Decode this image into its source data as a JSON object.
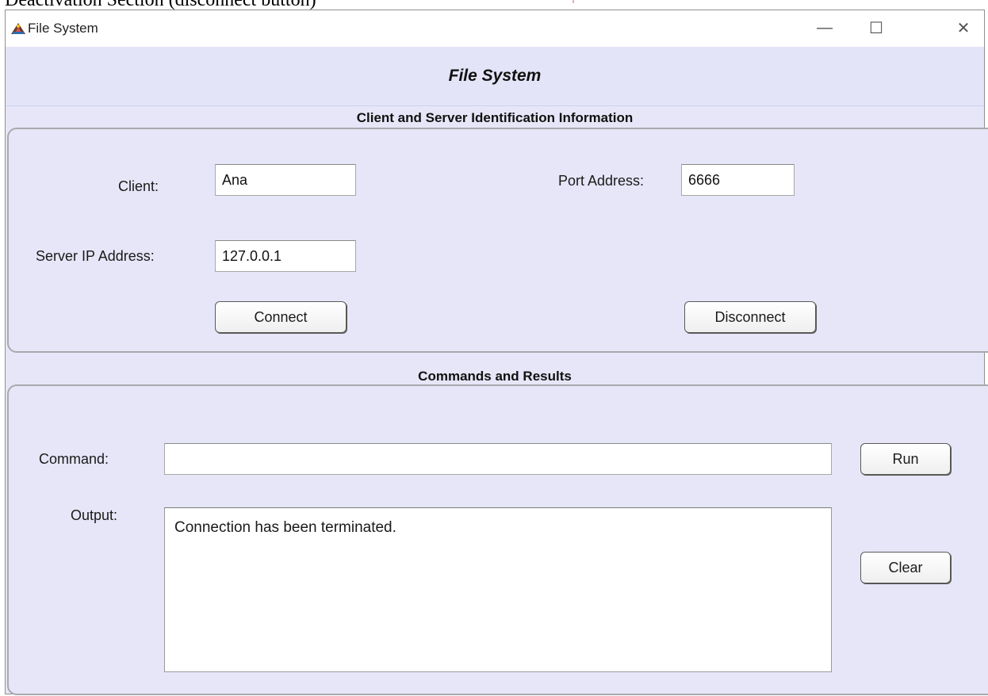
{
  "window": {
    "title": "File System",
    "app_title": "File System",
    "controls": {
      "minimize": "—",
      "maximize": "☐",
      "close": "✕"
    }
  },
  "top_caption": "Deactivation Section (disconnect button)",
  "identification_section": {
    "title": "Client and Server Identification Information",
    "client_label": "Client:",
    "client_value": "Ana",
    "port_label": "Port Address:",
    "port_value": "6666",
    "server_ip_label": "Server IP Address:",
    "server_ip_value": "127.0.0.1",
    "connect_button": "Connect",
    "disconnect_button": "Disconnect"
  },
  "commands_section": {
    "title": "Commands and Results",
    "command_label": "Command:",
    "command_value": "",
    "run_button": "Run",
    "output_label": "Output:",
    "output_value": "Connection has been terminated.",
    "clear_button": "Clear"
  },
  "icons": {
    "app_icon": "java-app-icon",
    "minimize": "minimize-icon",
    "maximize": "maximize-icon",
    "close": "close-icon"
  },
  "colors": {
    "window_bg": "#e6e6f8",
    "titlebar_bg": "#ffffff",
    "field_bg": "#ffffff"
  }
}
